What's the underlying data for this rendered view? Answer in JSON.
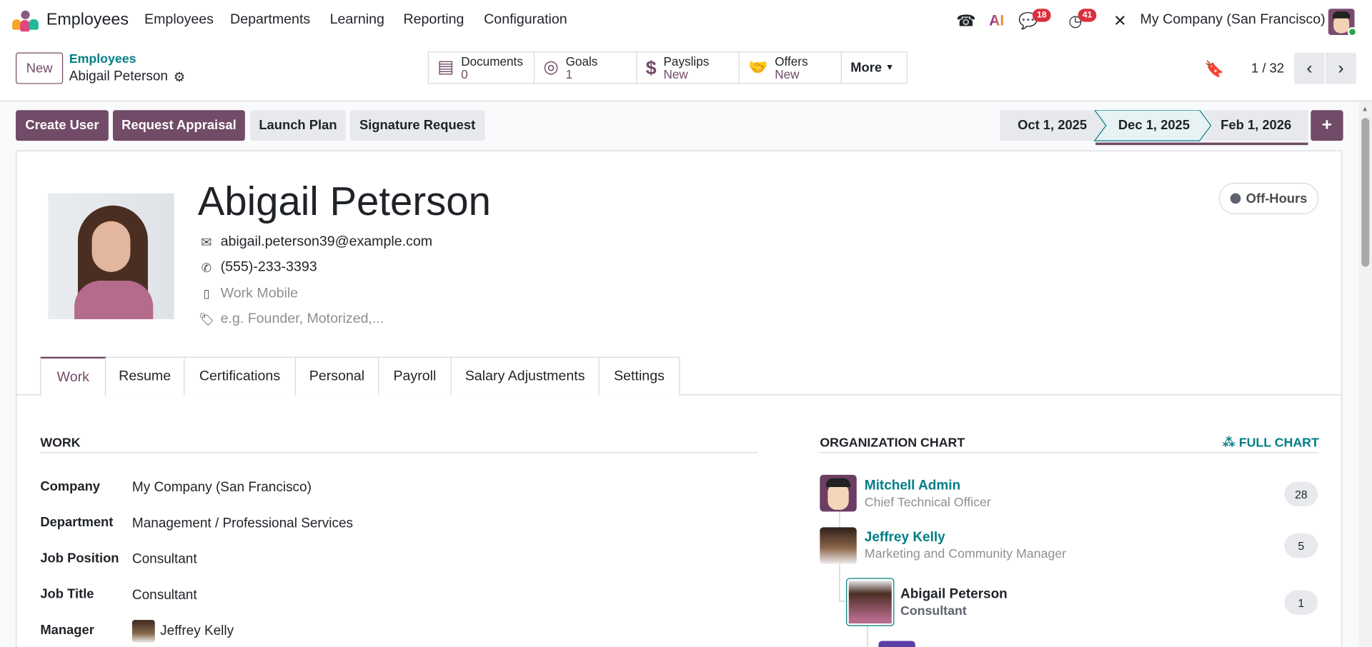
{
  "nav": {
    "app": "Employees",
    "menu": [
      "Employees",
      "Departments",
      "Learning",
      "Reporting",
      "Configuration"
    ],
    "chat_badge": "18",
    "activity_badge": "41",
    "ai_label": "AI",
    "company": "My Company (San Francisco)"
  },
  "control": {
    "new_label": "New",
    "breadcrumb_parent": "Employees",
    "breadcrumb_current": "Abigail Peterson",
    "smart_buttons": [
      {
        "label": "Documents",
        "value": "0"
      },
      {
        "label": "Goals",
        "value": "1"
      },
      {
        "label": "Payslips",
        "value": "New"
      },
      {
        "label": "Offers",
        "value": "New"
      }
    ],
    "more_label": "More",
    "pager": "1 / 32"
  },
  "actions": {
    "create_user": "Create User",
    "request_appraisal": "Request Appraisal",
    "launch_plan": "Launch Plan",
    "signature_request": "Signature Request"
  },
  "versions": [
    "Oct 1, 2025",
    "Dec 1, 2025",
    "Feb 1, 2026"
  ],
  "employee": {
    "name": "Abigail Peterson",
    "email": "abigail.peterson39@example.com",
    "phone": "(555)-233-3393",
    "mobile_placeholder": "Work Mobile",
    "tags_placeholder": "e.g. Founder, Motorized,...",
    "status": "Off-Hours"
  },
  "tabs": [
    "Work",
    "Resume",
    "Certifications",
    "Personal",
    "Payroll",
    "Salary Adjustments",
    "Settings"
  ],
  "work": {
    "title": "WORK",
    "fields": [
      {
        "label": "Company",
        "value": "My Company (San Francisco)"
      },
      {
        "label": "Department",
        "value": "Management / Professional Services"
      },
      {
        "label": "Job Position",
        "value": "Consultant"
      },
      {
        "label": "Job Title",
        "value": "Consultant"
      },
      {
        "label": "Manager",
        "value": "Jeffrey Kelly"
      }
    ]
  },
  "org": {
    "title": "ORGANIZATION CHART",
    "full_chart": "FULL CHART",
    "people": [
      {
        "name": "Mitchell Admin",
        "role": "Chief Technical Officer",
        "count": "28"
      },
      {
        "name": "Jeffrey Kelly",
        "role": "Marketing and Community Manager",
        "count": "5"
      },
      {
        "name": "Abigail Peterson",
        "role": "Consultant",
        "count": "1"
      }
    ]
  },
  "colors": {
    "brand": "#714b67",
    "teal": "#017e84"
  }
}
